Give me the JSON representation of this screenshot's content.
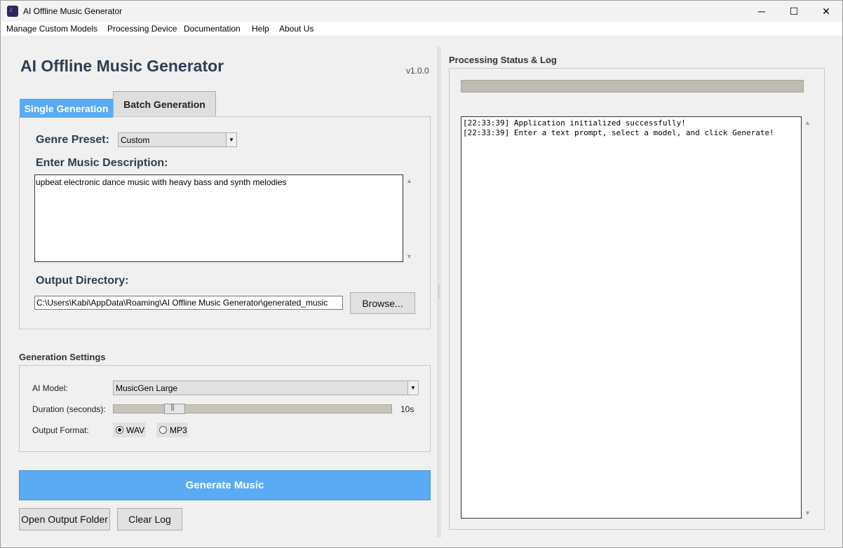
{
  "window": {
    "title": "AI Offline Music Generator",
    "controls": {
      "minimize": "─",
      "maximize": "☐",
      "close": "✕"
    }
  },
  "menu": [
    "Manage Custom Models",
    "Processing Device",
    "Documentation",
    "Help",
    "About Us"
  ],
  "header": {
    "title": "AI Offline Music Generator",
    "version": "v1.0.0"
  },
  "tabs": {
    "single": "Single Generation",
    "batch": "Batch Generation",
    "active": "Single Generation"
  },
  "single": {
    "genre_label": "Genre Preset:",
    "genre_value": "Custom",
    "description_label": "Enter Music Description:",
    "description_value": "upbeat electronic dance music with heavy bass and synth melodies",
    "output_label": "Output Directory:",
    "output_value": "C:\\Users\\Kabi\\AppData\\Roaming\\AI Offline Music Generator\\generated_music",
    "browse_label": "Browse..."
  },
  "settings": {
    "title": "Generation Settings",
    "model_label": "AI Model:",
    "model_value": "MusicGen Large",
    "duration_label": "Duration (seconds):",
    "duration_value": "10s",
    "duration_fraction": 0.22,
    "format_label": "Output Format:",
    "formats": [
      "WAV",
      "MP3"
    ],
    "format_selected": "WAV"
  },
  "actions": {
    "generate": "Generate Music",
    "open_folder": "Open Output Folder",
    "clear_log": "Clear Log"
  },
  "status": {
    "title": "Processing Status & Log",
    "progress": 0,
    "log": [
      "[22:33:39] Application initialized successfully!",
      "[22:33:39] Enter a text prompt, select a model, and click Generate!"
    ]
  },
  "colors": {
    "accent": "#5aabf4",
    "heading": "#2d3e50"
  }
}
